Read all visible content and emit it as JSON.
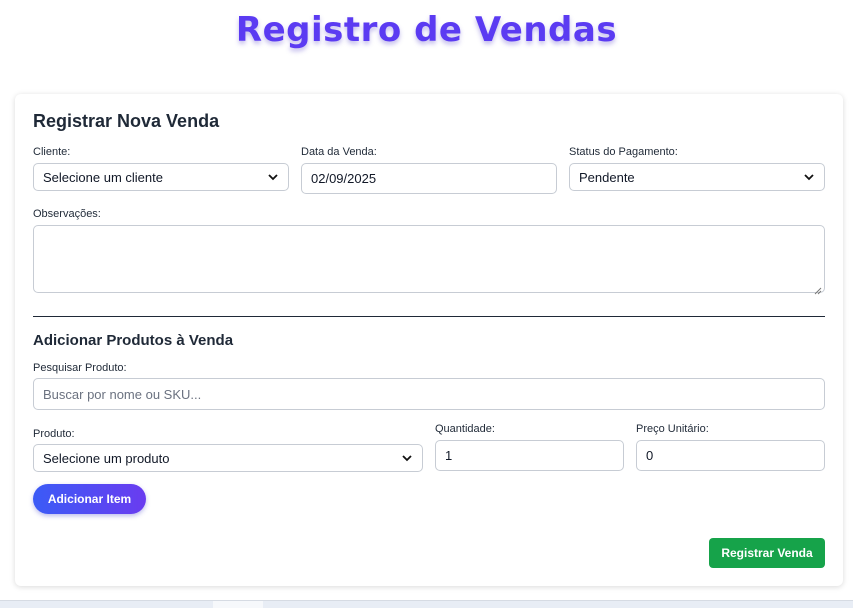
{
  "header": {
    "title": "Registro de Vendas"
  },
  "sale_form": {
    "title": "Registrar Nova Venda",
    "cliente": {
      "label": "Cliente:",
      "value": "Selecione um cliente"
    },
    "data_venda": {
      "label": "Data da Venda:",
      "value": "02/09/2025"
    },
    "status_pagamento": {
      "label": "Status do Pagamento:",
      "value": "Pendente"
    },
    "observacoes": {
      "label": "Observações:",
      "value": ""
    }
  },
  "products": {
    "title": "Adicionar Produtos à Venda",
    "search": {
      "label": "Pesquisar Produto:",
      "placeholder": "Buscar por nome ou SKU..."
    },
    "produto": {
      "label": "Produto:",
      "value": "Selecione um produto"
    },
    "quantidade": {
      "label": "Quantidade:",
      "value": "1"
    },
    "preco_unitario": {
      "label": "Preço Unitário:",
      "value": "0"
    },
    "add_button": "Adicionar Item"
  },
  "submit_button": "Registrar Venda",
  "colors": {
    "title": "#5b3bf2",
    "add_button_start": "#3b5bf6",
    "add_button_end": "#6a3cf0",
    "submit": "#16a34a"
  },
  "icons": [
    "chevron-down-icon",
    "resize-grip-icon"
  ]
}
